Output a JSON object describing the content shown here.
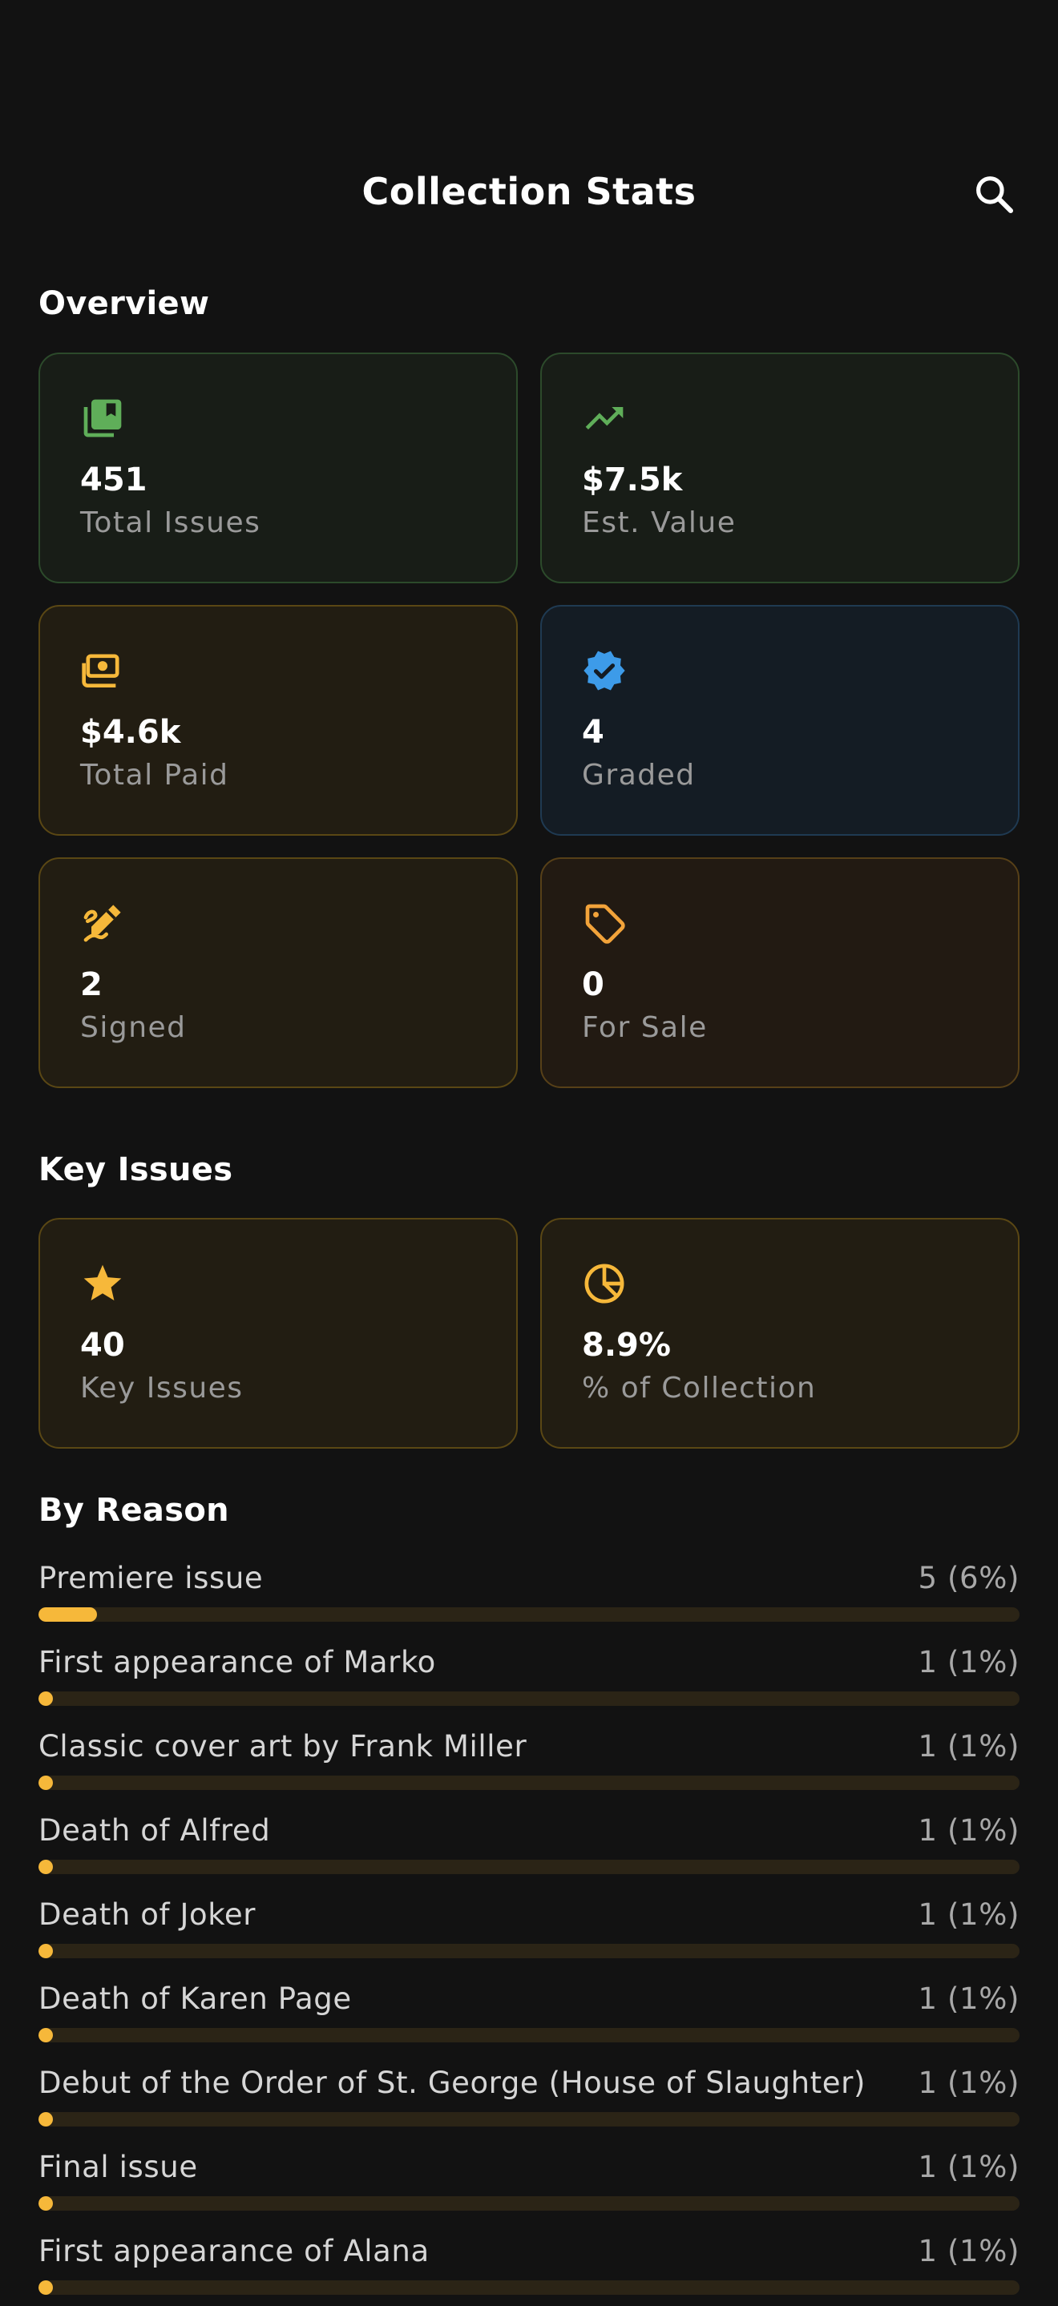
{
  "header": {
    "title": "Collection Stats",
    "search_icon": "search-icon"
  },
  "overview": {
    "title": "Overview",
    "cards": [
      {
        "value": "451",
        "label": "Total Issues",
        "icon": "library-books-icon",
        "icon_color": "#5fae59"
      },
      {
        "value": "$7.5k",
        "label": "Est. Value",
        "icon": "trending-up-icon",
        "icon_color": "#5fae59"
      },
      {
        "value": "$4.6k",
        "label": "Total Paid",
        "icon": "payments-icon",
        "icon_color": "#f6b83a"
      },
      {
        "value": "4",
        "label": "Graded",
        "icon": "verified-badge-icon",
        "icon_color": "#3d9be9"
      },
      {
        "value": "2",
        "label": "Signed",
        "icon": "signature-pen-icon",
        "icon_color": "#f6b83a"
      },
      {
        "value": "0",
        "label": "For Sale",
        "icon": "price-tag-icon",
        "icon_color": "#f2a33a"
      }
    ]
  },
  "key_issues": {
    "title": "Key Issues",
    "cards": [
      {
        "value": "40",
        "label": "Key Issues",
        "icon": "star-icon",
        "icon_color": "#f6b83a"
      },
      {
        "value": "8.9%",
        "label": "% of Collection",
        "icon": "pie-chart-icon",
        "icon_color": "#f6b83a"
      }
    ]
  },
  "by_reason": {
    "title": "By Reason",
    "accent": "#f6b83a",
    "items": [
      {
        "label": "Premiere issue",
        "count": "5 (6%)",
        "fraction": 0.06
      },
      {
        "label": "First appearance of Marko",
        "count": "1 (1%)",
        "fraction": 0.012
      },
      {
        "label": "Classic cover art by Frank Miller",
        "count": "1 (1%)",
        "fraction": 0.012
      },
      {
        "label": "Death of Alfred",
        "count": "1 (1%)",
        "fraction": 0.012
      },
      {
        "label": "Death of Joker",
        "count": "1 (1%)",
        "fraction": 0.012
      },
      {
        "label": "Death of Karen Page",
        "count": "1 (1%)",
        "fraction": 0.012
      },
      {
        "label": "Debut of the Order of St. George (House of Slaughter)",
        "count": "1 (1%)",
        "fraction": 0.012
      },
      {
        "label": "Final issue",
        "count": "1 (1%)",
        "fraction": 0.012
      },
      {
        "label": "First appearance of Alana",
        "count": "1 (1%)",
        "fraction": 0.012
      }
    ]
  }
}
